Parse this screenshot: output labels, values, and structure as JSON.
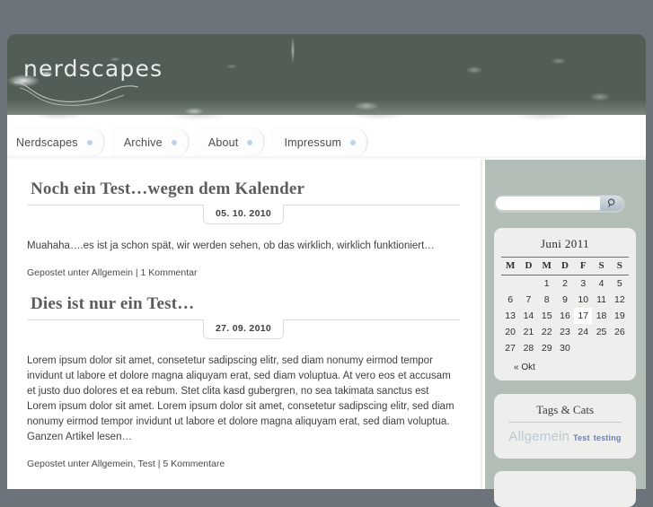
{
  "site": {
    "logo": "nerdscapes",
    "background_color": "#6d737b",
    "banner_color": "#525e55",
    "sidebar_color": "#b2bdb5",
    "accent_dot_color": "#bcd4ea"
  },
  "nav": {
    "items": [
      {
        "label": "Nerdscapes"
      },
      {
        "label": "Archive"
      },
      {
        "label": "About"
      },
      {
        "label": "Impressum"
      }
    ]
  },
  "posts": [
    {
      "title": "Noch ein Test…wegen dem Kalender",
      "date": "05. 10. 2010",
      "body": "Muahaha….es ist ja schon spät, wir werden sehen, ob das wirklich, wirklich funktioniert…",
      "read_more": "",
      "meta": "Gepostet unter Allgemein | 1 Kommentar"
    },
    {
      "title": "Dies ist nur ein Test…",
      "date": "27. 09. 2010",
      "body": "Lorem ipsum dolor sit amet, consetetur sadipscing elitr, sed diam nonumy eirmod tempor invidunt ut labore et dolore magna aliquyam erat, sed diam voluptua. At vero eos et accusam et justo duo dolores et ea rebum. Stet clita kasd gubergren, no sea takimata sanctus est Lorem ipsum dolor sit amet. Lorem ipsum dolor sit amet, consetetur sadipscing elitr, sed diam nonumy eirmod tempor invidunt ut labore et dolore magna aliquyam erat, sed diam voluptua.",
      "read_more": "Ganzen Artikel lesen…",
      "meta": "Gepostet unter Allgemein, Test | 5 Kommentare"
    }
  ],
  "sidebar": {
    "search": {
      "value": "",
      "placeholder": "",
      "button_icon": "search-icon"
    },
    "calendar": {
      "caption": "Juni 2011",
      "weekdays": [
        "M",
        "D",
        "M",
        "D",
        "F",
        "S",
        "S"
      ],
      "weeks": [
        [
          "",
          "",
          "1",
          "2",
          "3",
          "4",
          "5"
        ],
        [
          "6",
          "7",
          "8",
          "9",
          "10",
          "11",
          "12"
        ],
        [
          "13",
          "14",
          "15",
          "16",
          "17",
          "18",
          "19"
        ],
        [
          "20",
          "21",
          "22",
          "23",
          "24",
          "25",
          "26"
        ],
        [
          "27",
          "28",
          "29",
          "30",
          "",
          "",
          ""
        ]
      ],
      "today": "17",
      "prev_link": "« Okt"
    },
    "tags_widget": {
      "title": "Tags & Cats",
      "tags": [
        {
          "label": "Allgemein",
          "size": "large"
        },
        {
          "label": "Test",
          "size": "small"
        },
        {
          "label": "testing",
          "size": "small"
        }
      ]
    }
  }
}
